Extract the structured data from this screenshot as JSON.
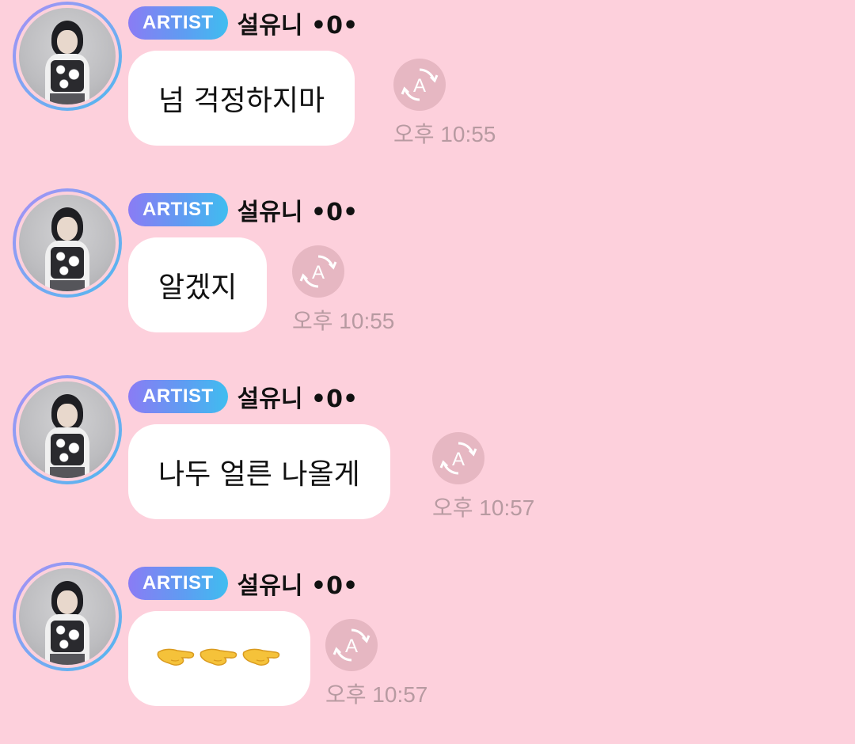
{
  "messages": [
    {
      "badge": "ARTIST",
      "sender": "설유니 •0•",
      "text": "넘 걱정하지마",
      "time": "오후 10:55"
    },
    {
      "badge": "ARTIST",
      "sender": "설유니 •0•",
      "text": "알겠지",
      "time": "오후 10:55"
    },
    {
      "badge": "ARTIST",
      "sender": "설유니 •0•",
      "text": "나두 얼른 나올게",
      "time": "오후 10:57"
    },
    {
      "badge": "ARTIST",
      "sender": "설유니 •0•",
      "text": "🫳🫳🫳",
      "time": "오후 10:57"
    }
  ],
  "icons": {
    "translate": "translate-icon",
    "emoji": "palm-down-hand-icon"
  },
  "colors": {
    "background": "#fdd0dc",
    "bubble": "#ffffff",
    "time": "#b79aa1",
    "badge_from": "#8a7cf4",
    "badge_to": "#3fbdf0"
  }
}
